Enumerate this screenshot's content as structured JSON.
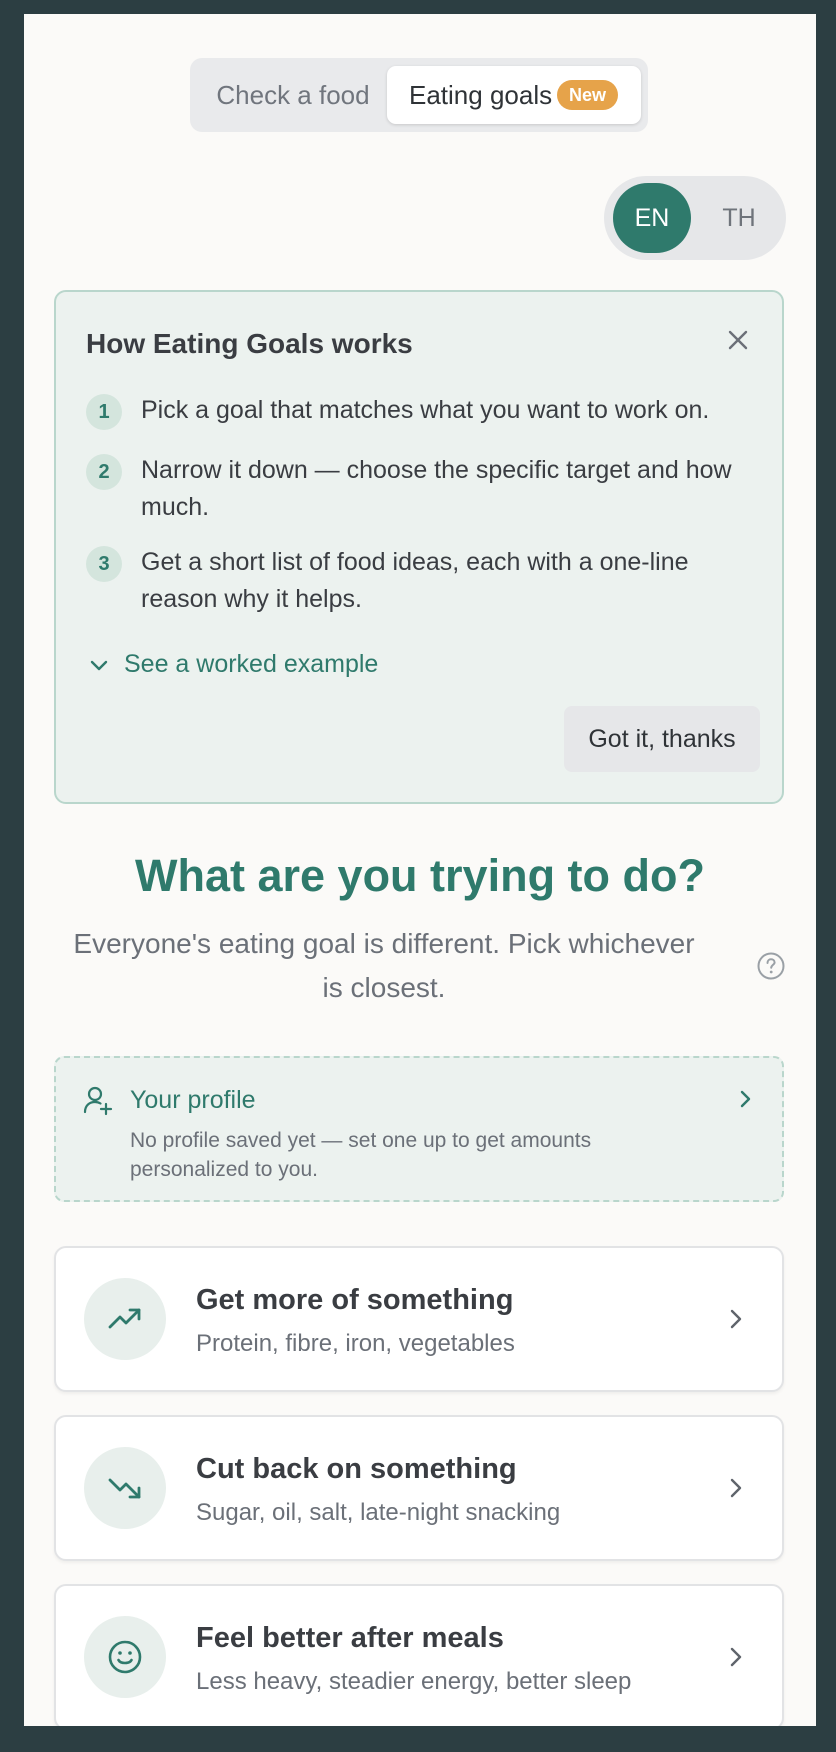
{
  "mode_switch": {
    "check_label": "Check a food",
    "goals_label": "Eating goals",
    "goals_badge": "New",
    "active": "Eating goals"
  },
  "language": {
    "en": "EN",
    "th": "TH",
    "active": "EN"
  },
  "info_card": {
    "title": "How Eating Goals works",
    "steps": [
      {
        "num": "1",
        "text": "Pick a goal that matches what you want to work on."
      },
      {
        "num": "2",
        "text": "Narrow it down — choose the specific target and how much."
      },
      {
        "num": "3",
        "text": "Get a short list of food ideas, each with a one-line reason why it helps."
      }
    ],
    "example_link": "See a worked example",
    "dismiss_label": "Got it, thanks"
  },
  "heading": {
    "title": "What are you trying to do?",
    "subtitle": "Everyone's eating goal is different. Pick whichever is closest."
  },
  "profile": {
    "title": "Your profile",
    "description": "No profile saved yet — set one up to get amounts personalized to you."
  },
  "goals": [
    {
      "title": "Get more of something",
      "description": "Protein, fibre, iron, vegetables",
      "icon": "trending-up-icon"
    },
    {
      "title": "Cut back on something",
      "description": "Sugar, oil, salt, late-night snacking",
      "icon": "trending-down-icon"
    },
    {
      "title": "Feel better after meals",
      "description": "Less heavy, steadier energy, better sleep",
      "icon": "smile-icon"
    }
  ],
  "colors": {
    "accent": "#2f7a6c",
    "badge": "#e6a34a",
    "card_tint": "#ecf2ef",
    "frame_background": "#2c3e42"
  }
}
